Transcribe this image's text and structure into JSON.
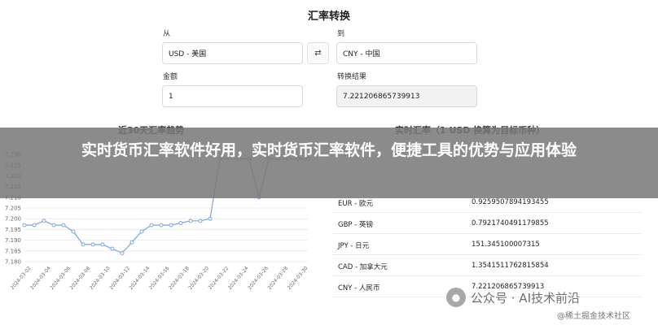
{
  "title": "汇率转换",
  "from": {
    "label": "从",
    "value": "USD - 美国"
  },
  "to": {
    "label": "到",
    "value": "CNY - 中国"
  },
  "swap": {
    "icon": "swap-arrows-icon",
    "glyph": "⇄"
  },
  "amount": {
    "label": "金额",
    "value": "1"
  },
  "result": {
    "label": "转换结果",
    "value": "7.221206865739913"
  },
  "trend_section": {
    "title": "近30天汇率趋势"
  },
  "rates_section": {
    "title": "实时汇率（1 USD 换算为目标币种）",
    "rows": [
      {
        "currency": "EUR - 欧元",
        "rate": "0.9259507894193455"
      },
      {
        "currency": "GBP - 英镑",
        "rate": "0.7921740491179855"
      },
      {
        "currency": "JPY - 日元",
        "rate": "151.345100007315"
      },
      {
        "currency": "CAD - 加拿大元",
        "rate": "1.3541511762815854"
      },
      {
        "currency": "CNY - 人民币",
        "rate": "7.221206865739913"
      }
    ]
  },
  "banner": {
    "text": "实时货币汇率软件好用，实时货币汇率软件，便捷工具的优势与应用体验"
  },
  "watermarks": {
    "primary": "公众号 · AI技术前沿",
    "secondary": "@稀土掘金技术社区"
  },
  "chart_data": {
    "type": "line",
    "x": [
      "2024-03-02",
      "2024-03-04",
      "2024-03-06",
      "2024-03-08",
      "2024-03-10",
      "2024-03-12",
      "2024-03-14",
      "2024-03-16",
      "2024-03-18",
      "2024-03-20",
      "2024-03-22",
      "2024-03-24",
      "2024-03-26",
      "2024-03-28",
      "2024-03-30"
    ],
    "y_ticks": [
      "7.230",
      "7.225",
      "7.220",
      "7.215",
      "7.210",
      "7.205",
      "7.200",
      "7.195",
      "7.190",
      "7.185",
      "7.180"
    ],
    "ylim": [
      7.18,
      7.23
    ],
    "series": [
      {
        "values": [
          7.197,
          7.197,
          7.199,
          7.197,
          7.197,
          7.194,
          7.188,
          7.188,
          7.188,
          7.186,
          7.184,
          7.189,
          7.194,
          7.197,
          7.197,
          7.197,
          7.198,
          7.199,
          7.199,
          7.2,
          7.228,
          7.228,
          7.228,
          7.228,
          7.21,
          7.228,
          7.228,
          7.228,
          7.228,
          7.228
        ]
      }
    ],
    "color": "#7fa6d9",
    "grid": true
  }
}
